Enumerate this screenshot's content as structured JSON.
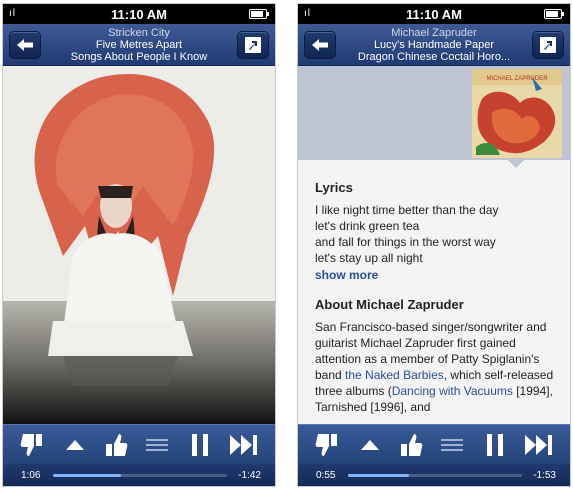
{
  "left": {
    "status": {
      "signal": "ıl",
      "time": "11:10 AM"
    },
    "nav": {
      "artist": "Stricken City",
      "track": "Five Metres Apart",
      "album": "Songs About People I Know",
      "back_icon": "back-arrow-icon",
      "share_icon": "share-arrow-icon"
    },
    "controls": {
      "thumb_down": "thumbs-down-icon",
      "up": "triangle-up-icon",
      "thumb_up": "thumbs-up-icon",
      "menu": "menu-lines-icon",
      "pause": "pause-icon",
      "skip": "skip-forward-icon"
    },
    "progress": {
      "elapsed": "1:06",
      "remaining": "-1:42",
      "fraction": 0.39
    }
  },
  "right": {
    "status": {
      "signal": "ıl",
      "time": "11:10 AM"
    },
    "nav": {
      "artist": "Michael Zapruder",
      "track": "Lucy's Handmade Paper",
      "album": "Dragon Chinese Coctail Horo...",
      "back_icon": "back-arrow-icon",
      "share_icon": "share-arrow-icon"
    },
    "info": {
      "thumb_title": "MICHAEL ZAPRUDER",
      "lyrics_heading": "Lyrics",
      "lyrics": [
        "I like night time better than the day",
        "let's drink green tea",
        "and fall for things in the worst way",
        "let's stay up all night"
      ],
      "show_more": "show more",
      "about_heading": "About Michael Zapruder",
      "about_1": "San Francisco-based singer/songwriter and guitarist Michael Zapruder first gained attention as a member of Patty Spiglanin's band ",
      "about_link_1": "the Naked Barbies",
      "about_2": ", which self-released three albums (",
      "about_link_2": "Dancing with Vacuums",
      "about_3": " [1994], Tarnished [1996], and"
    },
    "controls": {
      "thumb_down": "thumbs-down-icon",
      "up": "triangle-up-icon",
      "thumb_up": "thumbs-up-icon",
      "menu": "menu-lines-icon",
      "pause": "pause-icon",
      "skip": "skip-forward-icon"
    },
    "progress": {
      "elapsed": "0:55",
      "remaining": "-1:53",
      "fraction": 0.35
    }
  },
  "colors": {
    "nav_blue": "#2c4a85",
    "link_blue": "#2a4e9a",
    "progress_fill": "#7fb2ff"
  }
}
